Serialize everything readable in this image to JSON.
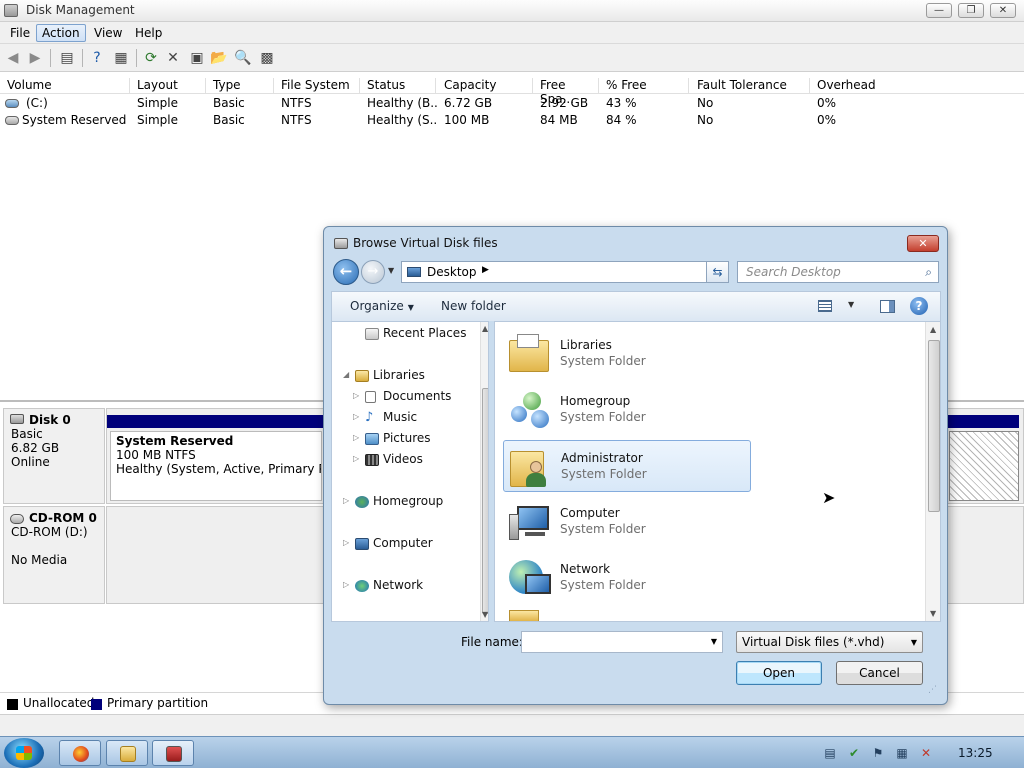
{
  "window": {
    "title": "Disk Management"
  },
  "menu": [
    "File",
    "Action",
    "View",
    "Help"
  ],
  "volume_table": {
    "columns": [
      "Volume",
      "Layout",
      "Type",
      "File System",
      "Status",
      "Capacity",
      "Free Spa...",
      "% Free",
      "Fault Tolerance",
      "Overhead"
    ],
    "rows": [
      [
        "(C:)",
        "Simple",
        "Basic",
        "NTFS",
        "Healthy (B...",
        "6.72 GB",
        "2.92 GB",
        "43 %",
        "No",
        "0%"
      ],
      [
        "System Reserved",
        "Simple",
        "Basic",
        "NTFS",
        "Healthy (S...",
        "100 MB",
        "84 MB",
        "84 %",
        "No",
        "0%"
      ]
    ]
  },
  "disks": [
    {
      "name": "Disk 0",
      "type": "Basic",
      "size": "6.82 GB",
      "state": "Online",
      "partition": {
        "name": "System Reserved",
        "size": "100 MB NTFS",
        "status": "Healthy (System, Active, Primary Partitio"
      }
    },
    {
      "name": "CD-ROM 0",
      "type": "CD-ROM (D:)",
      "state": "No Media"
    }
  ],
  "legend": [
    "Unallocated",
    "Primary partition"
  ],
  "colors": {
    "unallocated": "#000000",
    "primary_partition": "#00007b",
    "selection": "#cce8ff"
  },
  "dialog": {
    "title": "Browse Virtual Disk files",
    "address": "Desktop",
    "search_placeholder": "Search Desktop",
    "commands": {
      "organize": "Organize",
      "new_folder": "New folder"
    },
    "nav": {
      "recent_places": "Recent Places",
      "libraries": "Libraries",
      "documents": "Documents",
      "music": "Music",
      "pictures": "Pictures",
      "videos": "Videos",
      "homegroup": "Homegroup",
      "computer": "Computer",
      "network": "Network"
    },
    "items": [
      {
        "name": "Libraries",
        "type": "System Folder"
      },
      {
        "name": "Homegroup",
        "type": "System Folder"
      },
      {
        "name": "Administrator",
        "type": "System Folder"
      },
      {
        "name": "Computer",
        "type": "System Folder"
      },
      {
        "name": "Network",
        "type": "System Folder"
      }
    ],
    "file_name_label": "File name:",
    "file_name_value": "",
    "file_type": "Virtual Disk files (*.vhd)",
    "open_label": "Open",
    "cancel_label": "Cancel"
  },
  "taskbar": {
    "clock": "13:25"
  }
}
